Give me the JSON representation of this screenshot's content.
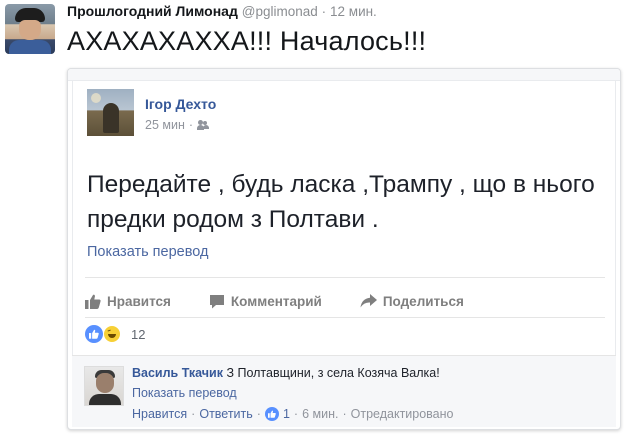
{
  "tweet": {
    "display_name": "Прошлогодний Лимонад",
    "handle": "@pglimonad",
    "separator": "·",
    "time": "12 мин.",
    "text": "АХАХАХАХХА!!! Началось!!!"
  },
  "fb_post": {
    "author": "Ігор Дехто",
    "time": "25 мин",
    "meta_separator": "·",
    "audience_icon": "friends-icon",
    "text": "Передайте , будь ласка ,Трампу , що в нього предки родом з Полтави .",
    "translate_link": "Показать перевод",
    "actions": {
      "like": "Нравится",
      "comment": "Комментарий",
      "share": "Поделиться"
    },
    "reactions": {
      "icons": [
        "like-reaction-icon",
        "haha-reaction-icon"
      ],
      "count": "12"
    },
    "comment": {
      "author": "Василь Ткачик",
      "text": "З Полтавщини, з села Козяча Валка!",
      "translate_link": "Показать перевод",
      "like_link": "Нравится",
      "reply_link": "Ответить",
      "separator": "·",
      "like_count": "1",
      "time": "6 мин.",
      "edited": "Отредактировано"
    }
  },
  "colors": {
    "fb_link": "#365899",
    "fb_blue": "#5890ff",
    "muted": "#90949c"
  }
}
